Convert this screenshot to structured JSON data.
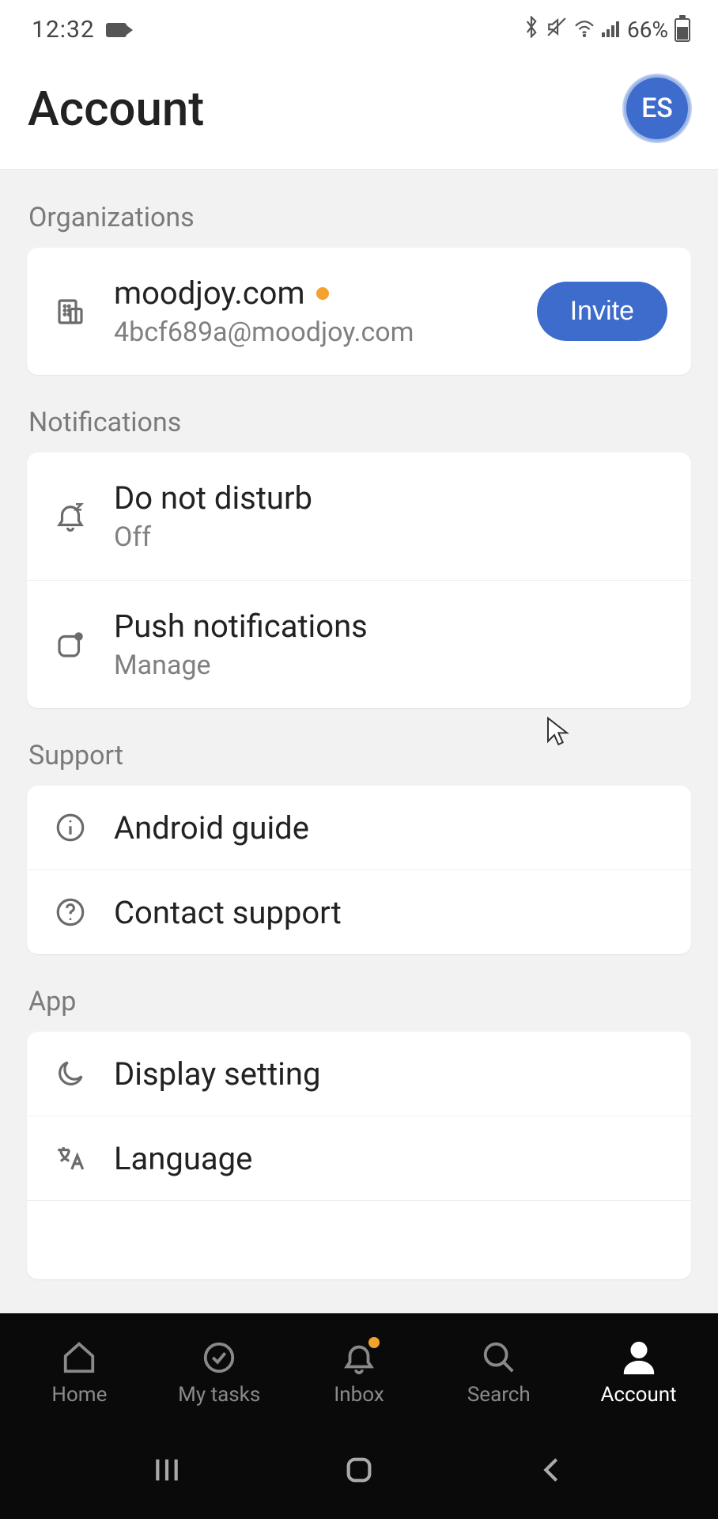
{
  "status": {
    "time": "12:32",
    "battery": "66%"
  },
  "header": {
    "title": "Account",
    "avatar_initials": "ES"
  },
  "sections": {
    "organizations": {
      "label": "Organizations",
      "org_name": "moodjoy.com",
      "org_email": "4bcf689a@moodjoy.com",
      "invite_label": "Invite"
    },
    "notifications": {
      "label": "Notifications",
      "dnd_title": "Do not disturb",
      "dnd_value": "Off",
      "push_title": "Push notifications",
      "push_value": "Manage"
    },
    "support": {
      "label": "Support",
      "guide": "Android guide",
      "contact": "Contact support"
    },
    "app": {
      "label": "App",
      "display": "Display setting",
      "language": "Language"
    }
  },
  "tabs": {
    "home": "Home",
    "tasks": "My tasks",
    "inbox": "Inbox",
    "search": "Search",
    "account": "Account"
  }
}
